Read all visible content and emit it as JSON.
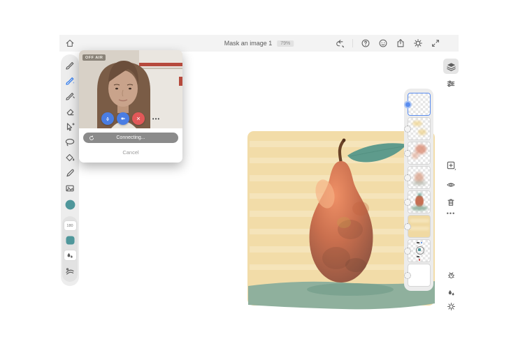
{
  "top_bar": {
    "title": "Mask an image 1",
    "zoom_level": "79%",
    "left_icons": [
      "home"
    ],
    "right_icons": [
      "undo",
      "help",
      "livestream",
      "publish",
      "settings",
      "fullscreen"
    ]
  },
  "toolbar": {
    "tools": [
      "paint-brush",
      "live-brush",
      "mixer-brush",
      "eraser",
      "move",
      "lasso",
      "fill",
      "eyedropper",
      "place-image"
    ],
    "active_tool": "live-brush",
    "active_tool_color": "#2f7bef",
    "active_color": "#4f979b",
    "brush_size": "180"
  },
  "video_call": {
    "status_badge": "OFF AIR",
    "connecting_label": "Connecting...",
    "cancel_label": "Cancel",
    "more_label": "•••",
    "buttons": [
      "microphone",
      "camera",
      "end-call",
      "more-options"
    ],
    "colors": {
      "mic_camera": "#4a7de2",
      "end_call": "#e25858",
      "pill": "#8b8b8b"
    }
  },
  "canvas": {
    "subject": "watercolor pear painting",
    "colors": {
      "wash": "#f2dca8",
      "stripe": "#f9ecc9",
      "ground": "#8fb09d",
      "shadow": "#79a18e",
      "pear_light": "#ef9066",
      "pear_mid": "#c96f4e",
      "pear_dark": "#875140",
      "leaf": "#5e9b8c",
      "stem": "#6a4227"
    }
  },
  "layers_panel": {
    "layers": [
      {
        "name": "layer-1",
        "content": "empty-transparent",
        "selected": true
      },
      {
        "name": "layer-2",
        "content": "yellow-highlight-strokes",
        "selected": false
      },
      {
        "name": "layer-3",
        "content": "red-wash-strokes",
        "selected": false
      },
      {
        "name": "layer-4",
        "content": "pear-underpainting",
        "selected": false
      },
      {
        "name": "layer-5",
        "content": "pear-and-ground",
        "selected": false
      },
      {
        "name": "layer-6",
        "content": "yellow-background-wash",
        "selected": false
      },
      {
        "name": "layer-7",
        "content": "reference-marks",
        "selected": false
      },
      {
        "name": "layer-8",
        "content": "white-background",
        "selected": false
      }
    ]
  },
  "right_rail": {
    "icons": [
      "layers",
      "layer-properties",
      "add-layer",
      "visibility",
      "delete",
      "more",
      "feedback",
      "color-adjust",
      "settings"
    ]
  }
}
